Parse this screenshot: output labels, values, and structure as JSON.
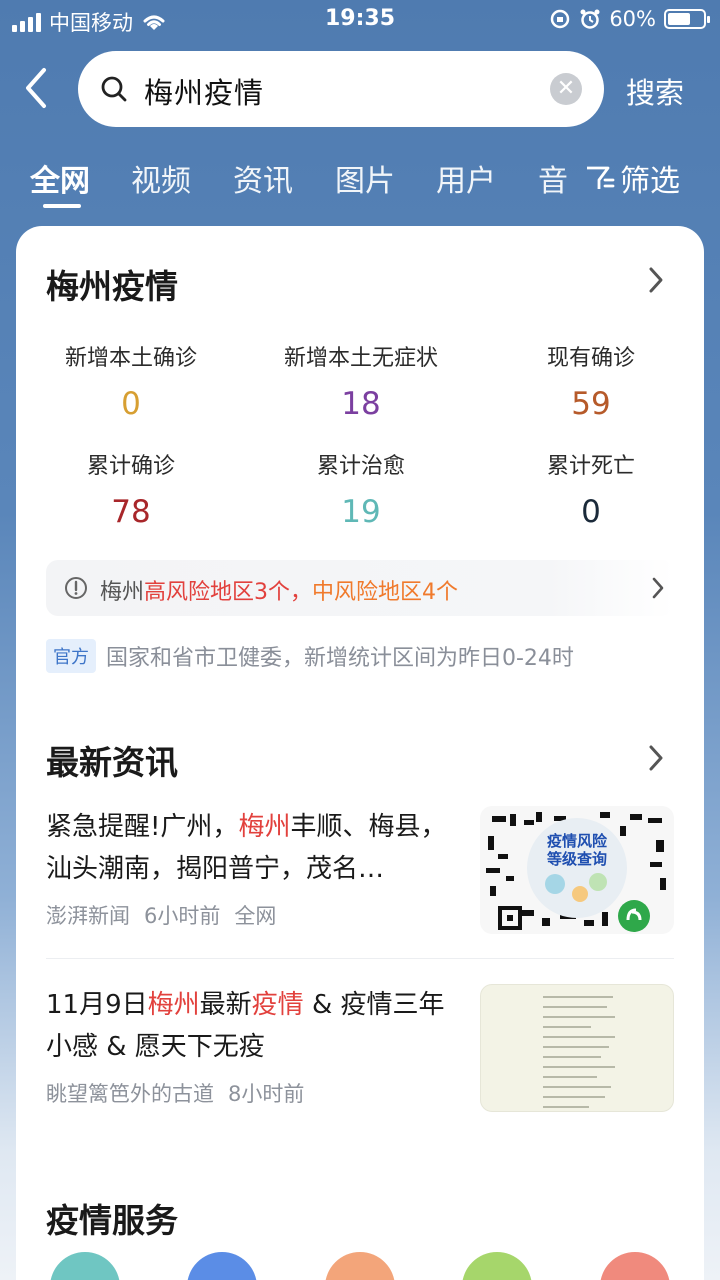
{
  "status_bar": {
    "carrier": "中国移动",
    "time": "19:35",
    "battery": "60%"
  },
  "search": {
    "query": "梅州疫情",
    "button_label": "搜索"
  },
  "tabs": [
    {
      "label": "全网",
      "active": true
    },
    {
      "label": "视频",
      "active": false
    },
    {
      "label": "资讯",
      "active": false
    },
    {
      "label": "图片",
      "active": false
    },
    {
      "label": "用户",
      "active": false
    },
    {
      "label": "音",
      "active": false
    }
  ],
  "filter_label": "筛选",
  "epidemic": {
    "title": "梅州疫情",
    "stats": [
      {
        "label": "新增本土确诊",
        "value": "0",
        "color": "#d79f32"
      },
      {
        "label": "新增本土无症状",
        "value": "18",
        "color": "#7b3fa0"
      },
      {
        "label": "现有确诊",
        "value": "59",
        "color": "#b65a2a"
      },
      {
        "label": "累计确诊",
        "value": "78",
        "color": "#a8262a"
      },
      {
        "label": "累计治愈",
        "value": "19",
        "color": "#5fb8b6"
      },
      {
        "label": "累计死亡",
        "value": "0",
        "color": "#1b2a3a"
      }
    ],
    "alert": {
      "prefix": "梅州",
      "high_risk": "高风险地区3个，",
      "mid_risk": "中风险地区4个",
      "high_color": "#e2413d",
      "mid_color": "#f07a2c"
    },
    "source_badge": "官方",
    "source_text": "国家和省市卫健委，新增统计区间为昨日0-24时"
  },
  "news": {
    "title": "最新资讯",
    "items": [
      {
        "title_parts": [
          "紧急提醒!广州，",
          "梅州",
          "丰顺、梅县，汕头潮南，揭阳普宁，茂名…"
        ],
        "source": "澎湃新闻",
        "time": "6小时前",
        "scope": "全网",
        "thumb_text_1": "疫情风险",
        "thumb_text_2": "等级查询"
      },
      {
        "title_parts": [
          "11月9日",
          "梅州",
          "最新",
          "疫情",
          " & 疫情三年小感 & 愿天下无疫"
        ],
        "source": "眺望篱笆外的古道",
        "time": "8小时前"
      }
    ]
  },
  "services": {
    "title": "疫情服务",
    "colors": [
      "#6fc6c2",
      "#5b8de6",
      "#f3a57a",
      "#a6d66b",
      "#f08a7d"
    ]
  }
}
